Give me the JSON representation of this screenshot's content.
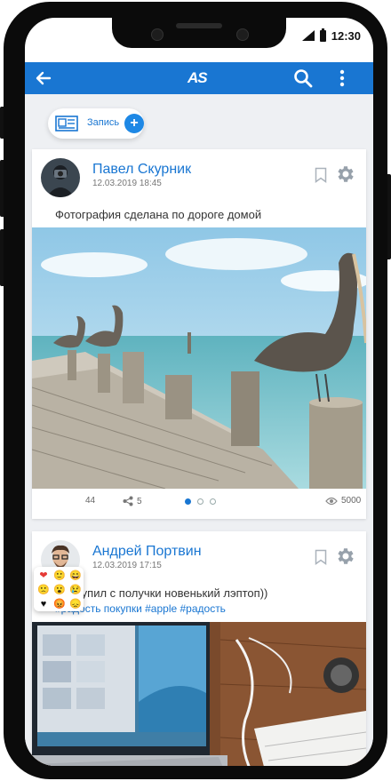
{
  "status_bar": {
    "time": "12:30"
  },
  "app_bar": {
    "logo": "AS"
  },
  "create_post": {
    "label": "Запись",
    "plus": "+"
  },
  "posts": [
    {
      "author": "Павел Скурник",
      "date": "12.03.2019 18:45",
      "text": "Фотография сделана по дороге домой",
      "comments": "44",
      "shares": "5",
      "views": "5000",
      "reactions": [
        "❤",
        "🙂",
        "😄",
        "🙁",
        "😮",
        "😢",
        "♥",
        "😡",
        "😞"
      ]
    },
    {
      "author": "Андрей Портвин",
      "date": "12.03.2019 17:15",
      "text": "Прикупил с получки новенький лэптоп))",
      "tags": "#радость покупки #apple #радость"
    }
  ],
  "colors": {
    "accent": "#1976d2",
    "background": "#eef0f3"
  }
}
